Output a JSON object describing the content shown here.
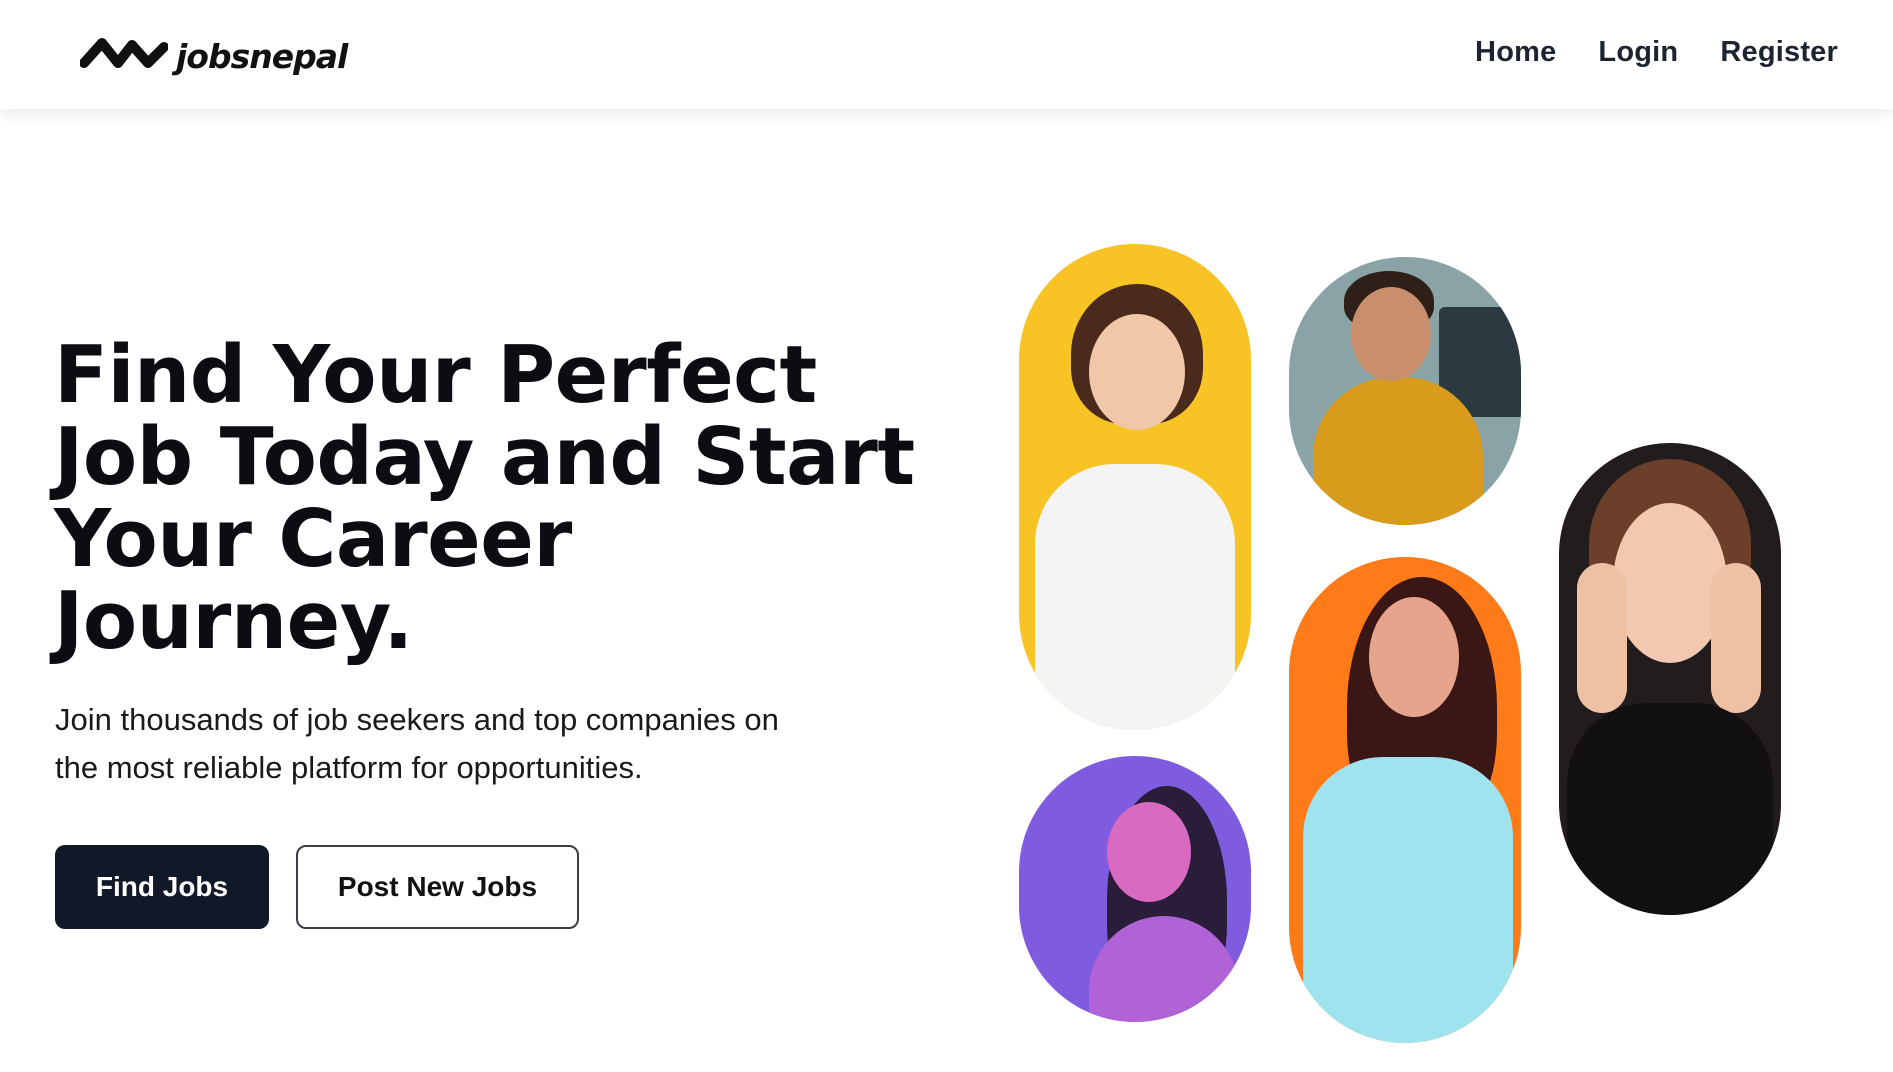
{
  "brand": {
    "name": "jobsnepal",
    "logo_icon": "zigzag-mark-icon"
  },
  "nav": {
    "items": [
      {
        "label": "Home"
      },
      {
        "label": "Login"
      },
      {
        "label": "Register"
      }
    ]
  },
  "hero": {
    "title_lines": [
      "Find Your Perfect",
      "Job Today and Start",
      "Your Career",
      "Journey."
    ],
    "subtitle_lines": [
      "Join thousands of job seekers and top companies on",
      "the most reliable platform for opportunities."
    ],
    "primary_button": "Find Jobs",
    "secondary_button": "Post New Jobs"
  },
  "colors": {
    "primary_button_bg": "#111827",
    "text_dark": "#0b0d12",
    "photo_bg_yellow": "#f7c325",
    "photo_bg_office": "#8aa3a6",
    "photo_bg_purple": "#7f5be0",
    "photo_bg_orange": "#ff7a18",
    "photo_bg_dark": "#231c1c"
  },
  "gallery": {
    "photos": [
      {
        "subject": "woman-with-glasses-photo"
      },
      {
        "subject": "smiling-man-at-desk-photo"
      },
      {
        "subject": "neon-portrait-woman-photo"
      },
      {
        "subject": "woman-in-white-coat-photo"
      },
      {
        "subject": "woman-hands-on-face-photo"
      }
    ]
  }
}
